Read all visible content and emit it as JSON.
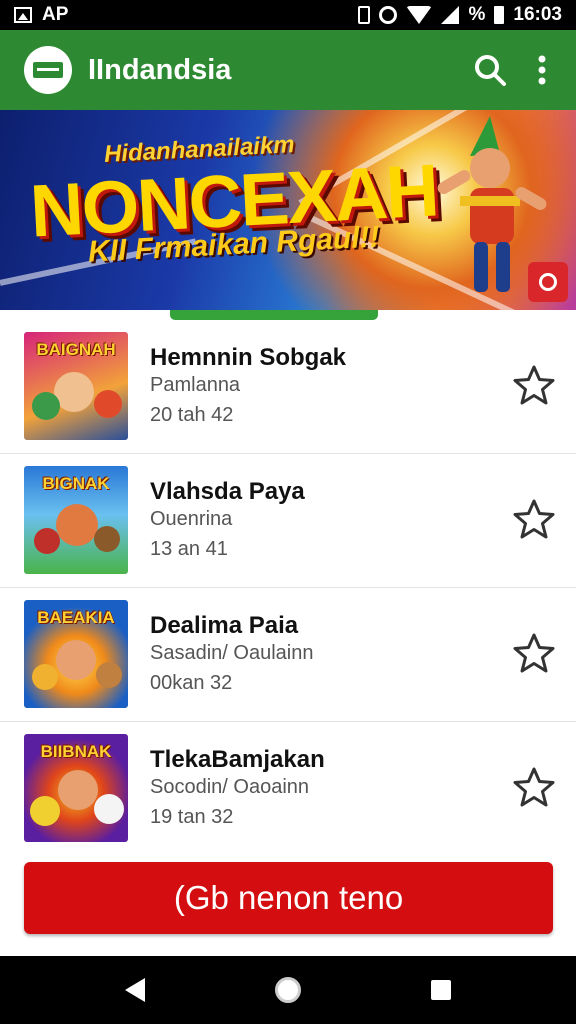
{
  "status_bar": {
    "left_text": "AP",
    "battery_percent": "%",
    "time": "16:03"
  },
  "app_bar": {
    "title": "IIndandsia"
  },
  "banner": {
    "subtitle": "Hidanhanailaikm",
    "title": "NONCEXAH",
    "tagline": "KII Frmaikan Rgaul!!"
  },
  "list": {
    "items": [
      {
        "thumb_label": "BAIGNAH",
        "title": "Hemnnin Sobgak",
        "subtitle": "Pamlanna",
        "meta": "20 tah 42",
        "thumb_colors": [
          "#d6247a",
          "#f2a23a"
        ]
      },
      {
        "thumb_label": "BIGNAK",
        "title": "Vlahsda Paya",
        "subtitle": "Ouenrina",
        "meta": "13 an 41",
        "thumb_colors": [
          "#2a78d6",
          "#4ab34a"
        ]
      },
      {
        "thumb_label": "BAEAKIA",
        "title": "Dealima Paia",
        "subtitle": "Sasadin/ Oaulainn",
        "meta": "00kan 32",
        "thumb_colors": [
          "#1a5fc4",
          "#f4b322"
        ]
      },
      {
        "thumb_label": "BIIBNAK",
        "title": "TlekaBamjakan",
        "subtitle": "Socodin/ Oaoainn",
        "meta": "19 tan 32",
        "thumb_colors": [
          "#5a1ea0",
          "#f0c020"
        ]
      }
    ]
  },
  "cta": {
    "label": "(Gb nenon teno"
  },
  "colors": {
    "app_bar": "#2d8a32",
    "cta": "#d40e10",
    "banner_action": "#d9262a"
  }
}
